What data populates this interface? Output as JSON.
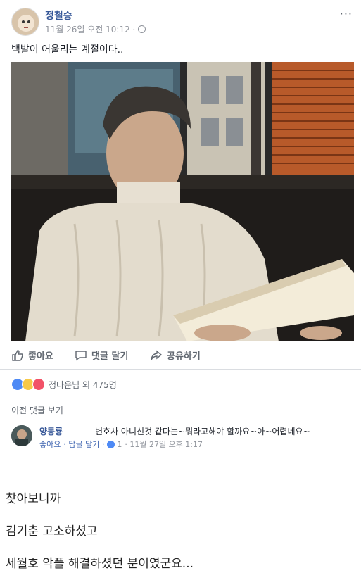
{
  "post": {
    "author": "정철승",
    "timestamp": "11월 26일 오전 10:12 ·",
    "more_label": "···",
    "status_text": "백발이 어울리는 계절이다.."
  },
  "actions": {
    "like_label": "좋아요",
    "comment_label": "댓글 달기",
    "share_label": "공유하기"
  },
  "reactions": {
    "summary": "정다운님 외 475명",
    "icons": [
      "like-reaction",
      "wow-reaction",
      "love-reaction"
    ],
    "colors": {
      "like": "#4e8af5",
      "wow": "#f7c948",
      "love": "#f25268"
    }
  },
  "comments": {
    "previous_label": "이전 댓글 보기",
    "items": [
      {
        "author": "양동룡",
        "text": "변호사 아니신것 같다는~뭐라고해야 할까요~아~어렵네요~",
        "like_label": "좋아요",
        "reply_label": "· 답글 달기 ·",
        "like_count": "1",
        "time": "· 11월 27일 오후 1:17"
      }
    ]
  },
  "caption_lines": [
    "찾아보니까",
    "김기춘 고소하셨고",
    "세월호 악플 해결하셨던 분이였군요..."
  ],
  "colors": {
    "link": "#365899",
    "meta": "#90949c",
    "action": "#606770"
  }
}
